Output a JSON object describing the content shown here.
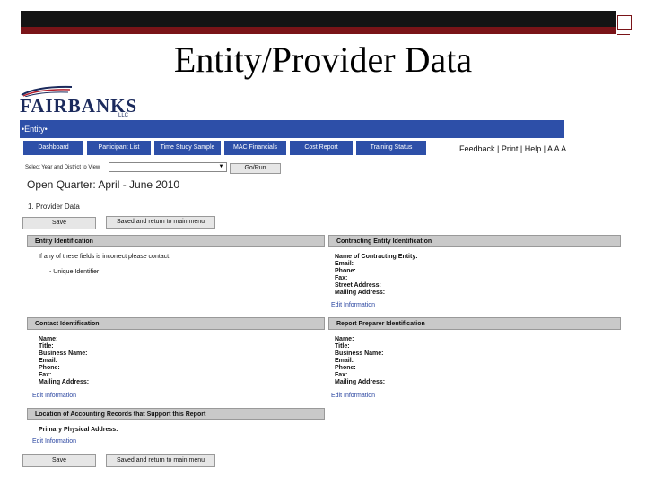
{
  "slide": {
    "title": "Entity/Provider Data"
  },
  "logo": {
    "name": "FAIRBANKS",
    "suffix": "LLC"
  },
  "app": {
    "entity_bar": "•Entity•",
    "nav_tabs": [
      "Dashboard",
      "Participant List",
      "Time Study Sample",
      "MAC Financials",
      "Cost Report",
      "Training Status"
    ],
    "top_links": "Feedback | Print | Help | A A A",
    "select_label": "Select Year and District to View",
    "select_value": "",
    "go_button": "Go/Run",
    "open_quarter": "Open Quarter: April - June 2010",
    "section_heading": "1. Provider Data",
    "save_label": "Save",
    "save_return_label": "Saved and return to main menu"
  },
  "entity_identification": {
    "title": "Entity Identification",
    "note": "If any of these fields is incorrect please contact:",
    "field": "- Unique Identifier"
  },
  "contracting_entity": {
    "title": "Contracting Entity Identification",
    "fields": [
      "Name of Contracting Entity:",
      "Email:",
      "Phone:",
      "Fax:",
      "Street Address:",
      "Mailing Address:"
    ],
    "edit_link": "Edit Information"
  },
  "contact_identification": {
    "title": "Contact Identification",
    "fields": [
      "Name:",
      "Title:",
      "Business Name:",
      "Email:",
      "Phone:",
      "Fax:",
      "Mailing Address:"
    ],
    "edit_link": "Edit Information"
  },
  "report_preparer": {
    "title": "Report Preparer Identification",
    "fields": [
      "Name:",
      "Title:",
      "Business Name:",
      "Email:",
      "Phone:",
      "Fax:",
      "Mailing Address:"
    ],
    "edit_link": "Edit Information"
  },
  "accounting_records": {
    "title": "Location of Accounting Records that Support this Report",
    "field": "Primary Physical Address:",
    "edit_link": "Edit Information"
  }
}
